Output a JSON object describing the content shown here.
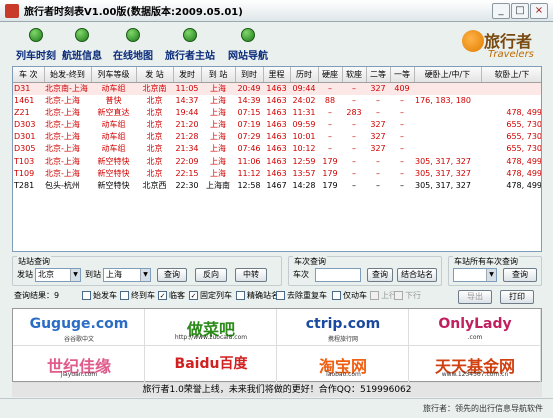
{
  "window": {
    "title": "旅行者时刻表V1.00版(数据版本:2009.05.01)",
    "minimize": "_",
    "maximize": "□",
    "close": "×"
  },
  "toolbar": {
    "buttons": [
      "列车时刻",
      "航班信息",
      "在线地图",
      "旅行者主站",
      "网站导航"
    ]
  },
  "logo": {
    "brand": "旅行者",
    "sub": "Travelers"
  },
  "table": {
    "columns": [
      "车 次",
      "始发-终到",
      "列车等级",
      "发 站",
      "发时",
      "到 站",
      "到时",
      "里程",
      "历时",
      "硬座",
      "软座",
      "二等",
      "一等",
      "硬卧上/中/下",
      "软卧上/下"
    ],
    "rows": [
      {
        "red": true,
        "sel": true,
        "cells": [
          "D31",
          "北京南-上海",
          "动车组",
          "北京南",
          "11:05",
          "上海",
          "20:49",
          "1463",
          "09:44",
          "–",
          "–",
          "327",
          "409",
          "",
          ""
        ]
      },
      {
        "red": true,
        "sel": false,
        "cells": [
          "1461",
          "北京-上海",
          "普快",
          "北京",
          "14:37",
          "上海",
          "14:39",
          "1463",
          "24:02",
          "88",
          "–",
          "–",
          "–",
          "176, 183, 180",
          ""
        ]
      },
      {
        "red": true,
        "sel": false,
        "cells": [
          "Z21",
          "北京-上海",
          "新空直达",
          "北京",
          "19:44",
          "上海",
          "07:15",
          "1463",
          "11:31",
          "–",
          "283",
          "–",
          "–",
          "",
          "478, 499"
        ]
      },
      {
        "red": true,
        "sel": false,
        "cells": [
          "D303",
          "北京-上海",
          "动车组",
          "北京",
          "21:20",
          "上海",
          "07:19",
          "1463",
          "09:59",
          "–",
          "–",
          "327",
          "–",
          "",
          "655, 730"
        ]
      },
      {
        "red": true,
        "sel": false,
        "cells": [
          "D301",
          "北京-上海",
          "动车组",
          "北京",
          "21:28",
          "上海",
          "07:29",
          "1463",
          "10:01",
          "–",
          "–",
          "327",
          "–",
          "",
          "655, 730"
        ]
      },
      {
        "red": true,
        "sel": false,
        "cells": [
          "D305",
          "北京-上海",
          "动车组",
          "北京",
          "21:34",
          "上海",
          "07:46",
          "1463",
          "10:12",
          "–",
          "–",
          "327",
          "–",
          "",
          "655, 730"
        ]
      },
      {
        "red": true,
        "sel": false,
        "cells": [
          "T103",
          "北京-上海",
          "新空特快",
          "北京",
          "22:09",
          "上海",
          "11:06",
          "1463",
          "12:59",
          "179",
          "–",
          "–",
          "–",
          "305, 317, 327",
          "478, 499"
        ]
      },
      {
        "red": true,
        "sel": false,
        "cells": [
          "T109",
          "北京-上海",
          "新空特快",
          "北京",
          "22:15",
          "上海",
          "11:12",
          "1463",
          "13:57",
          "179",
          "–",
          "–",
          "–",
          "305, 317, 327",
          "478, 499"
        ]
      },
      {
        "red": false,
        "sel": false,
        "cells": [
          "T281",
          "包头-杭州",
          "新空特快",
          "北京西",
          "22:30",
          "上海南",
          "12:58",
          "1467",
          "14:28",
          "179",
          "–",
          "–",
          "–",
          "305, 317, 327",
          "478, 499"
        ]
      }
    ]
  },
  "station_query": {
    "title": "站站查询",
    "from_label": "发站",
    "from_value": "北京",
    "to_label": "到站",
    "to_value": "上海",
    "query_button": "查询",
    "reverse_button": "反向",
    "transfer_button": "中转"
  },
  "train_query": {
    "title": "车次查询",
    "label": "车次",
    "value": "",
    "query_button": "查询",
    "combo_button": "结合站名"
  },
  "all_trains": {
    "title": "车站所有车次查询",
    "value": "",
    "query_button": "查询"
  },
  "results": {
    "label": "查询结果：9",
    "filters": [
      {
        "label": "始发车",
        "checked": false,
        "disabled": false
      },
      {
        "label": "终到车",
        "checked": false,
        "disabled": false
      },
      {
        "label": "临客",
        "checked": true,
        "disabled": false
      },
      {
        "label": "固定列车",
        "checked": true,
        "disabled": false
      },
      {
        "label": "精确站名",
        "checked": false,
        "disabled": false
      },
      {
        "label": "去除重复车",
        "checked": false,
        "disabled": false
      },
      {
        "label": "仅动车",
        "checked": false,
        "disabled": false
      },
      {
        "label": "上行",
        "checked": false,
        "disabled": true
      },
      {
        "label": "下行",
        "checked": false,
        "disabled": true
      }
    ],
    "export_button": "导出",
    "print_button": "打印"
  },
  "ads": [
    {
      "text": "Guguge.com",
      "sub": "谷谷歌中文",
      "color": "#2b6cc4"
    },
    {
      "text": "做菜吧",
      "sub": "http://www.zuocai8.com",
      "color": "#2c8a1a"
    },
    {
      "text": "ctrip.com",
      "sub": "携程旅行网",
      "color": "#1a4aa0"
    },
    {
      "text": "OnlyLady",
      "sub": ".com",
      "color": "#c02060"
    },
    {
      "text": "世纪佳缘",
      "sub": "jiayuan.com",
      "color": "#e05a8a"
    },
    {
      "text": "Baidu百度",
      "sub": "",
      "color": "#d02020"
    },
    {
      "text": "淘宝网",
      "sub": "Taobao.com",
      "color": "#f06010"
    },
    {
      "text": "天天基金网",
      "sub": "www.1234567.com.cn",
      "color": "#d04010"
    }
  ],
  "status": "旅行者1.0荣誉上线，未来我们将做的更好！合作QQ：519996062",
  "footer": "旅行者：领先的出行信息导航软件",
  "colors": {
    "accent_red": "#d00000",
    "toolbar_green": "#1f7a1a",
    "window_bg": "#e9f0ee"
  }
}
